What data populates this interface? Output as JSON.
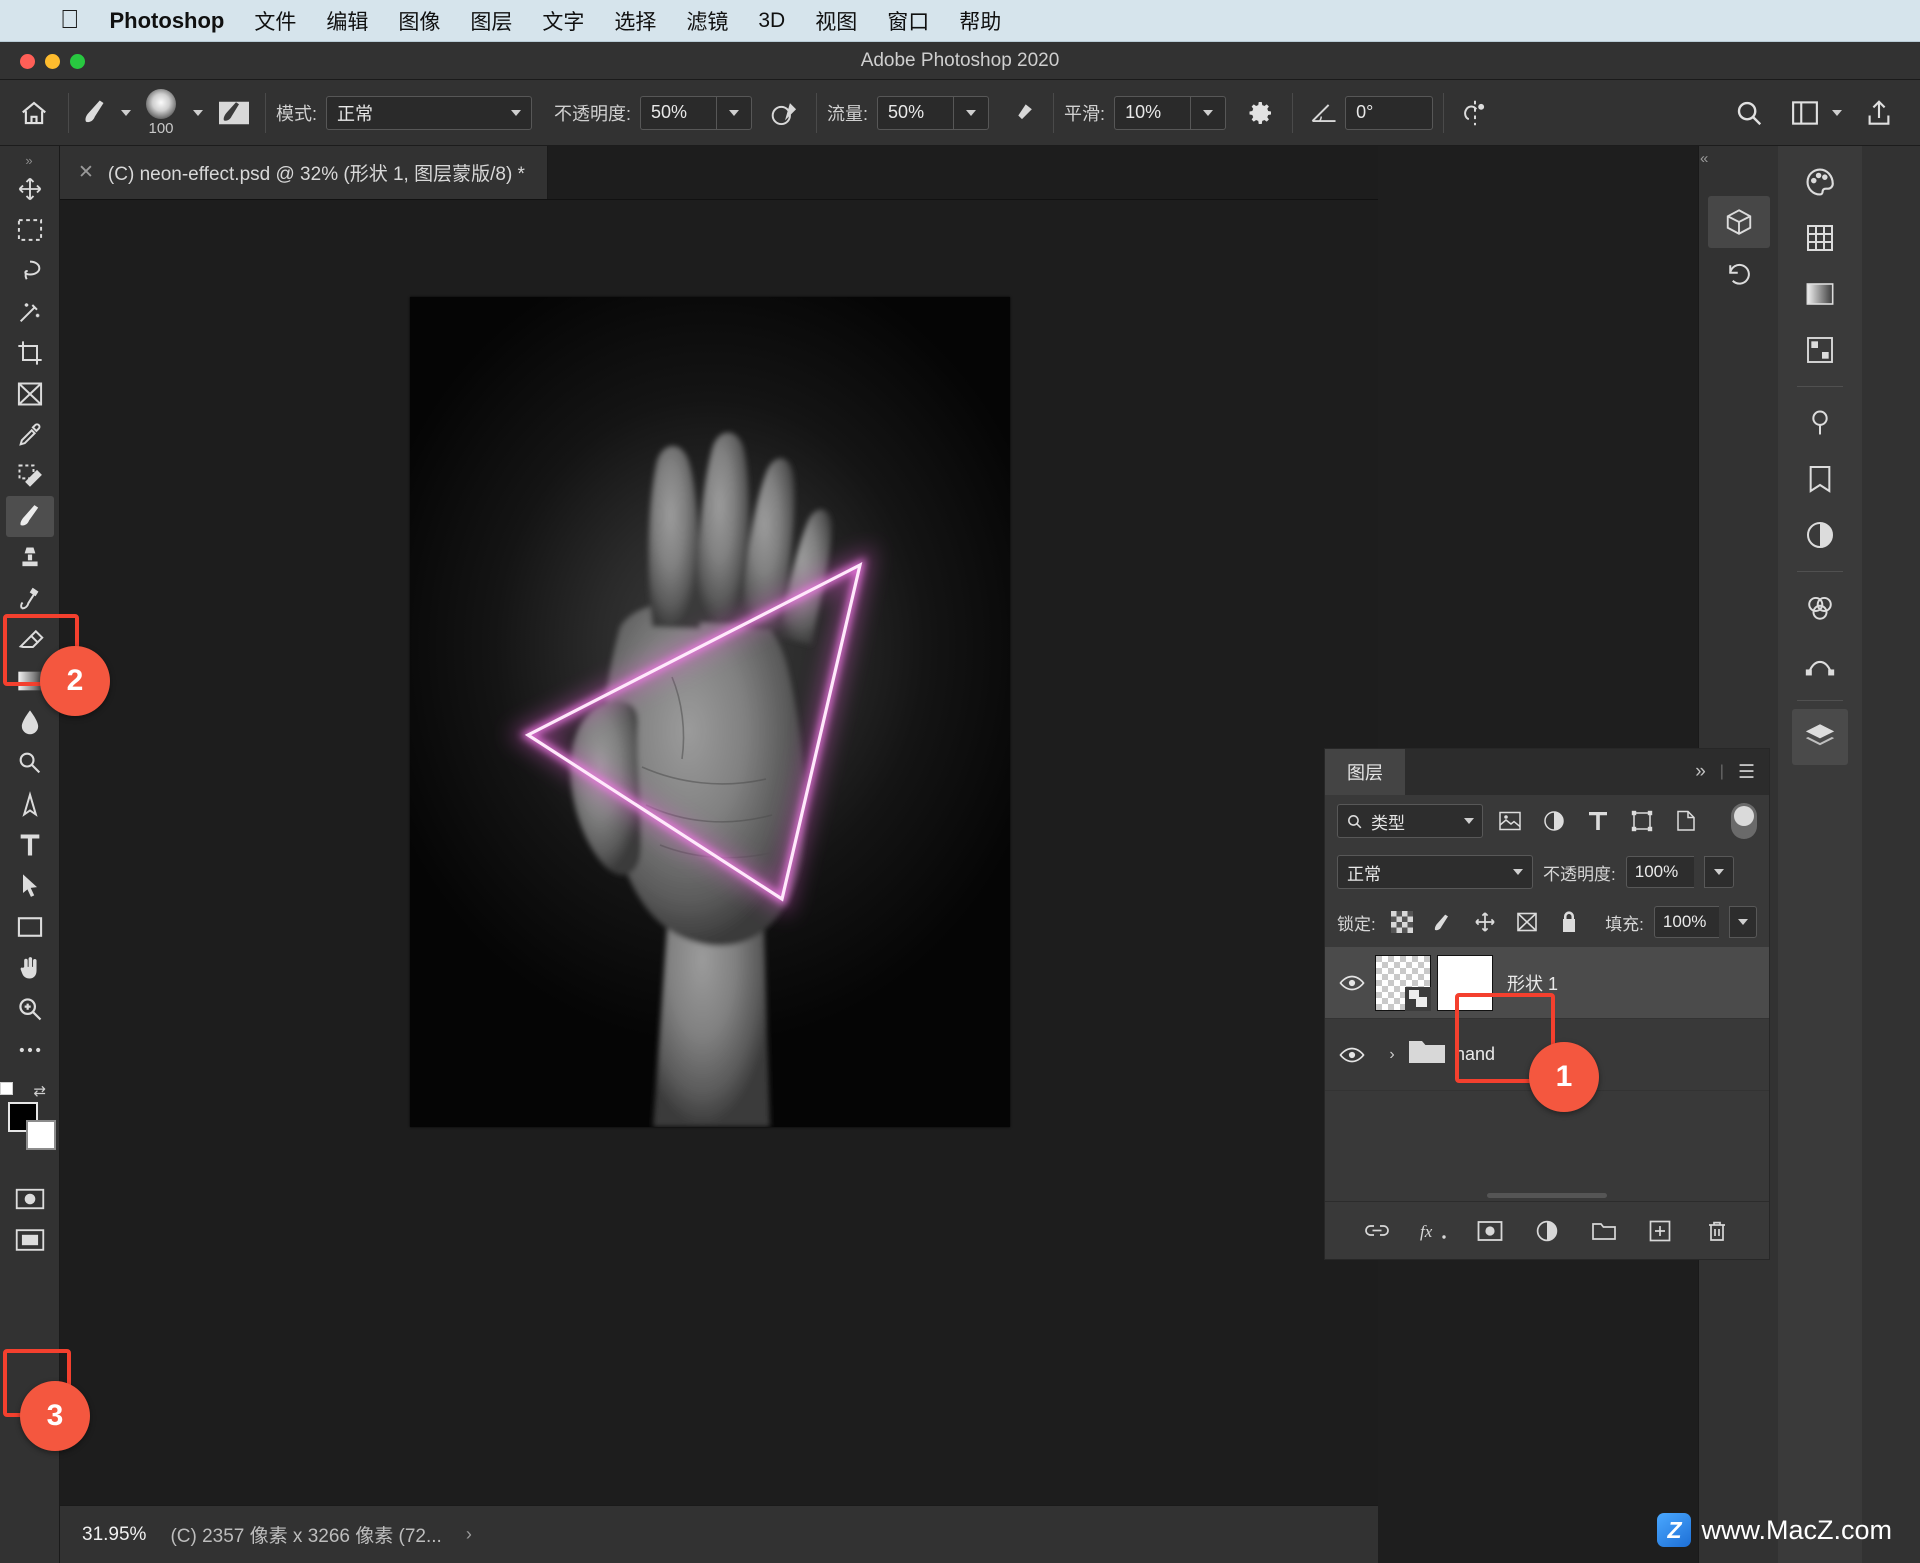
{
  "menubar": {
    "app_name": "Photoshop",
    "apple_icon": "apple-logo-icon",
    "items": [
      "文件",
      "编辑",
      "图像",
      "图层",
      "文字",
      "选择",
      "滤镜",
      "3D",
      "视图",
      "窗口",
      "帮助"
    ]
  },
  "titlebar": {
    "title": "Adobe Photoshop 2020"
  },
  "options_bar": {
    "home_icon": "home-icon",
    "brush_icon": "brush-preset-icon",
    "brush_size": "100",
    "brush_settings_icon": "brush-settings-icon",
    "mode_label": "模式:",
    "mode_value": "正常",
    "opacity_label": "不透明度:",
    "opacity_value": "50%",
    "pressure_opacity_icon": "pressure-opacity-icon",
    "flow_label": "流量:",
    "flow_value": "50%",
    "airbrush_icon": "airbrush-icon",
    "smoothing_label": "平滑:",
    "smoothing_value": "10%",
    "gear_icon": "gear-icon",
    "angle_icon": "brush-angle-icon",
    "angle_value": "0°",
    "symmetry_icon": "symmetry-icon",
    "search_icon": "search-icon",
    "arrange_icon": "arrange-documents-icon",
    "share_icon": "share-icon"
  },
  "tab": {
    "close_icon": "close-icon",
    "title": "(C) neon-effect.psd @ 32% (形状 1, 图层蒙版/8) *"
  },
  "toolbar": {
    "grip": "⋮⋮",
    "tools": [
      {
        "name": "move-tool",
        "glyph": "move"
      },
      {
        "name": "marquee-tool",
        "glyph": "marquee"
      },
      {
        "name": "lasso-tool",
        "glyph": "lasso"
      },
      {
        "name": "magic-wand-tool",
        "glyph": "wand"
      },
      {
        "name": "crop-tool",
        "glyph": "crop"
      },
      {
        "name": "frame-tool",
        "glyph": "frame"
      },
      {
        "name": "eyedropper-tool",
        "glyph": "eyedropper"
      },
      {
        "name": "spot-healing-tool",
        "glyph": "healing"
      },
      {
        "name": "brush-tool",
        "glyph": "brush"
      },
      {
        "name": "clone-stamp-tool",
        "glyph": "stamp"
      },
      {
        "name": "history-brush-tool",
        "glyph": "historybrush"
      },
      {
        "name": "eraser-tool",
        "glyph": "eraser"
      },
      {
        "name": "gradient-tool",
        "glyph": "gradient"
      },
      {
        "name": "blur-tool",
        "glyph": "blur"
      },
      {
        "name": "dodge-tool",
        "glyph": "dodge"
      },
      {
        "name": "pen-tool",
        "glyph": "pen"
      },
      {
        "name": "type-tool",
        "glyph": "type"
      },
      {
        "name": "path-selection-tool",
        "glyph": "pathselect"
      },
      {
        "name": "rectangle-tool",
        "glyph": "rectangle"
      },
      {
        "name": "hand-tool",
        "glyph": "hand"
      },
      {
        "name": "zoom-tool",
        "glyph": "zoom"
      },
      {
        "name": "more-tools",
        "glyph": "ellipsis"
      }
    ],
    "foreground_color": "#000000",
    "background_color": "#ffffff",
    "quickmask_name": "quick-mask-icon",
    "screenmode_name": "screen-mode-icon"
  },
  "statusbar": {
    "zoom": "31.95%",
    "dimensions": "(C) 2357 像素 x 3266 像素 (72...",
    "arrow": "›"
  },
  "layers_panel": {
    "tab_label": "图层",
    "collapse_icon": "chevron-double-right-icon",
    "menu_icon": "panel-menu-icon",
    "filter": {
      "search_icon": "search-icon",
      "kind_label": "类型",
      "icons": [
        "pixel-layers-icon",
        "adjustment-layers-icon",
        "type-layers-icon",
        "shape-layers-icon",
        "smart-object-icon"
      ],
      "toggle_name": "filter-toggle"
    },
    "blend_mode": "正常",
    "opacity_label": "不透明度:",
    "opacity_value": "100%",
    "lock_label": "锁定:",
    "lock_icons": [
      "lock-transparent-pixels-icon",
      "lock-image-pixels-icon",
      "lock-position-icon",
      "lock-artboard-nesting-icon",
      "lock-all-icon"
    ],
    "fill_label": "填充:",
    "fill_value": "100%",
    "layers": [
      {
        "name": "形状 1",
        "visible": true,
        "type": "shape",
        "has_mask": true,
        "selected": true
      },
      {
        "name": "hand",
        "visible": true,
        "type": "group",
        "has_mask": false,
        "selected": false
      }
    ],
    "footer_icons": [
      "link-layers-icon",
      "layer-style-fx-icon",
      "add-layer-mask-icon",
      "new-adjustment-layer-icon",
      "new-group-icon",
      "new-layer-icon",
      "delete-layer-icon"
    ]
  },
  "right_dock": {
    "collapse_icon": "chevron-double-right-icon",
    "mini_icons": [
      "3d-panel-icon",
      "history-panel-icon"
    ],
    "icons": [
      "color-panel-icon",
      "swatches-panel-icon",
      "gradients-panel-icon",
      "patterns-panel-icon",
      "adjustments-panel-icon",
      "libraries-panel-icon",
      "properties-panel-icon",
      "channels-panel-icon",
      "paths-panel-icon",
      "layers-panel-icon"
    ]
  },
  "annotations": [
    {
      "label": "1",
      "target": "layer-mask-thumbnail"
    },
    {
      "label": "2",
      "target": "brush-tool"
    },
    {
      "label": "3",
      "target": "foreground-color-swatch"
    }
  ],
  "watermark": {
    "logo": "Z",
    "text": "www.MacZ.com"
  },
  "colors": {
    "menubar_bg": "#d6e4ec",
    "panel_bg": "#323232",
    "canvas_bg": "#1d1d1d",
    "annotation": "#f4402e",
    "neon": "#f07be8"
  }
}
